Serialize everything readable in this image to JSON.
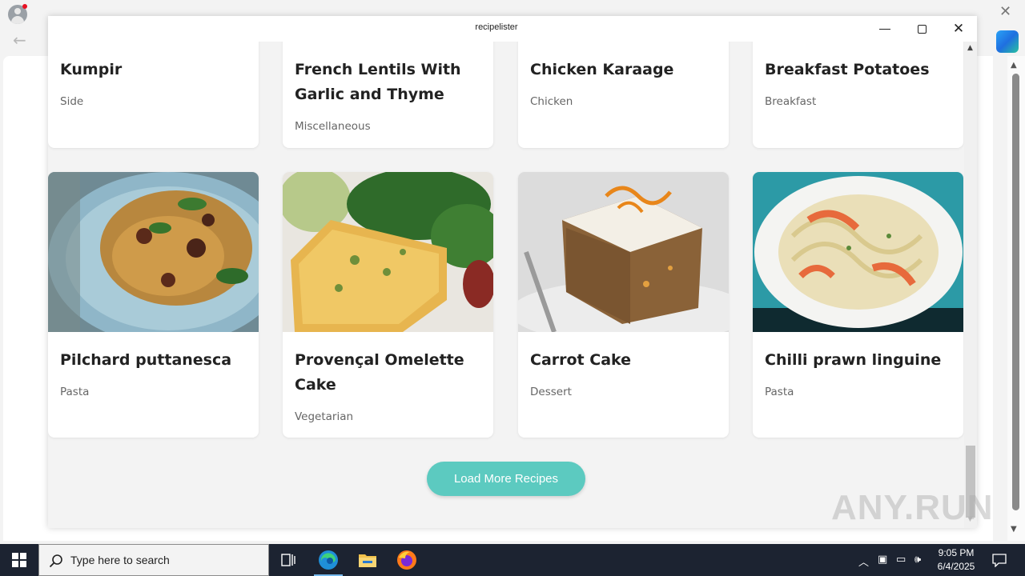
{
  "app": {
    "title": "recipelister"
  },
  "recipes_row1": [
    {
      "title": "Kumpir",
      "category": "Side"
    },
    {
      "title": "French Lentils With Garlic and Thyme",
      "category": "Miscellaneous"
    },
    {
      "title": "Chicken Karaage",
      "category": "Chicken"
    },
    {
      "title": "Breakfast Potatoes",
      "category": "Breakfast"
    }
  ],
  "recipes_row2": [
    {
      "title": "Pilchard puttanesca",
      "category": "Pasta",
      "image_icon": "pasta-plate-photo"
    },
    {
      "title": "Provençal Omelette Cake",
      "category": "Vegetarian",
      "image_icon": "omelette-slice-photo"
    },
    {
      "title": "Carrot Cake",
      "category": "Dessert",
      "image_icon": "carrot-cake-photo"
    },
    {
      "title": "Chilli prawn linguine",
      "category": "Pasta",
      "image_icon": "prawn-linguine-photo"
    }
  ],
  "load_more_label": "Load More Recipes",
  "colors": {
    "accent": "#5ccac0",
    "app_background": "#f3f3f3",
    "card_background": "#ffffff",
    "taskbar": "#1c2331"
  },
  "watermark": "ANY.RUN",
  "taskbar": {
    "search_placeholder": "Type here to search",
    "time": "9:05 PM",
    "date": "6/4/2025"
  }
}
